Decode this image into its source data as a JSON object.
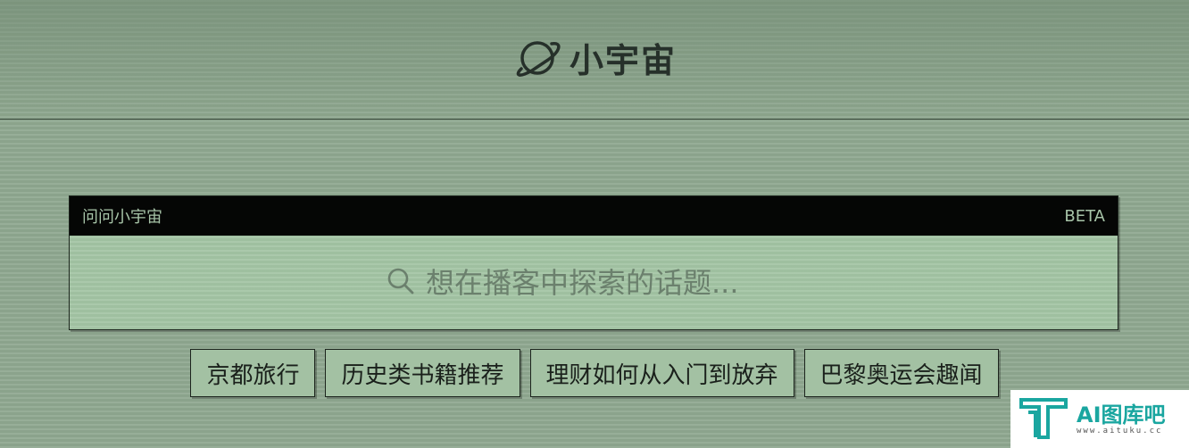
{
  "header": {
    "brand_name": "小宇宙",
    "brand_icon": "planet-icon"
  },
  "ask": {
    "title": "问问小宇宙",
    "badge": "BETA",
    "search_placeholder": "想在播客中探索的话题...",
    "search_value": "",
    "search_icon": "search-icon"
  },
  "suggestions": [
    {
      "label": "京都旅行"
    },
    {
      "label": "历史类书籍推荐"
    },
    {
      "label": "理财如何从入门到放弃"
    },
    {
      "label": "巴黎奥运会趣闻"
    }
  ],
  "watermark": {
    "title": "AI图库吧",
    "url": "www.aituku.cc"
  },
  "colors": {
    "background": "#8fa890",
    "panel_bar": "#050605",
    "panel_text": "#a7c4a8",
    "chip_background": "#a3c1a3",
    "watermark_accent": "#1aa6a0"
  }
}
